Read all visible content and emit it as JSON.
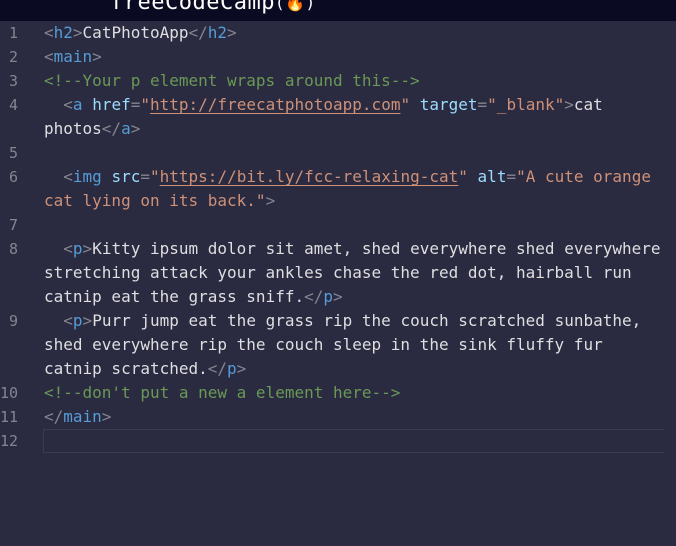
{
  "brand": {
    "name": "freeCodeCamp",
    "flame_icon": "flame-icon"
  },
  "colors": {
    "background": "#2a2a40",
    "topbar": "#0a0a23",
    "tag_name": "#569cd6",
    "attribute": "#9cdcfe",
    "string": "#ce9178",
    "comment": "#6a9955",
    "text": "#dfdfe2",
    "line_number": "#858591"
  },
  "editor": {
    "lines": [
      {
        "number": "1",
        "tokens": [
          {
            "t": "punct",
            "v": "<"
          },
          {
            "t": "tname",
            "v": "h2"
          },
          {
            "t": "punct",
            "v": ">"
          },
          {
            "t": "text",
            "v": "CatPhotoApp"
          },
          {
            "t": "punct",
            "v": "</"
          },
          {
            "t": "tname",
            "v": "h2"
          },
          {
            "t": "punct",
            "v": ">"
          }
        ]
      },
      {
        "number": "2",
        "tokens": [
          {
            "t": "punct",
            "v": "<"
          },
          {
            "t": "tname",
            "v": "main"
          },
          {
            "t": "punct",
            "v": ">"
          }
        ]
      },
      {
        "number": "3",
        "tokens": [
          {
            "t": "comment",
            "v": "<!--Your p element wraps around this-->"
          }
        ]
      },
      {
        "number": "4",
        "tokens": [
          {
            "t": "text",
            "v": "  "
          },
          {
            "t": "punct",
            "v": "<"
          },
          {
            "t": "tname",
            "v": "a"
          },
          {
            "t": "text",
            "v": " "
          },
          {
            "t": "attr",
            "v": "href"
          },
          {
            "t": "punct",
            "v": "="
          },
          {
            "t": "str",
            "v": "\""
          },
          {
            "t": "link",
            "v": "http://freecatphotoapp.com"
          },
          {
            "t": "str",
            "v": "\""
          },
          {
            "t": "text",
            "v": " "
          },
          {
            "t": "attr",
            "v": "target"
          },
          {
            "t": "punct",
            "v": "="
          },
          {
            "t": "str",
            "v": "\"_blank\""
          },
          {
            "t": "punct",
            "v": ">"
          },
          {
            "t": "text",
            "v": "cat photos"
          },
          {
            "t": "punct",
            "v": "</"
          },
          {
            "t": "tname",
            "v": "a"
          },
          {
            "t": "punct",
            "v": ">"
          }
        ]
      },
      {
        "number": "5",
        "tokens": []
      },
      {
        "number": "6",
        "tokens": [
          {
            "t": "text",
            "v": "  "
          },
          {
            "t": "punct",
            "v": "<"
          },
          {
            "t": "tname",
            "v": "img"
          },
          {
            "t": "text",
            "v": " "
          },
          {
            "t": "attr",
            "v": "src"
          },
          {
            "t": "punct",
            "v": "="
          },
          {
            "t": "str",
            "v": "\""
          },
          {
            "t": "link",
            "v": "https://bit.ly/fcc-relaxing-cat"
          },
          {
            "t": "str",
            "v": "\""
          },
          {
            "t": "text",
            "v": " "
          },
          {
            "t": "attr",
            "v": "alt"
          },
          {
            "t": "punct",
            "v": "="
          },
          {
            "t": "str",
            "v": "\"A cute orange cat lying on its back.\""
          },
          {
            "t": "punct",
            "v": ">"
          }
        ]
      },
      {
        "number": "7",
        "tokens": []
      },
      {
        "number": "8",
        "tokens": [
          {
            "t": "text",
            "v": "  "
          },
          {
            "t": "punct",
            "v": "<"
          },
          {
            "t": "tname",
            "v": "p"
          },
          {
            "t": "punct",
            "v": ">"
          },
          {
            "t": "text",
            "v": "Kitty ipsum dolor sit amet, shed everywhere shed everywhere stretching attack your ankles chase the red dot, hairball run catnip eat the grass sniff."
          },
          {
            "t": "punct",
            "v": "</"
          },
          {
            "t": "tname",
            "v": "p"
          },
          {
            "t": "punct",
            "v": ">"
          }
        ]
      },
      {
        "number": "9",
        "tokens": [
          {
            "t": "text",
            "v": "  "
          },
          {
            "t": "punct",
            "v": "<"
          },
          {
            "t": "tname",
            "v": "p"
          },
          {
            "t": "punct",
            "v": ">"
          },
          {
            "t": "text",
            "v": "Purr jump eat the grass rip the couch scratched sunbathe, shed everywhere rip the couch sleep in the sink fluffy fur catnip scratched."
          },
          {
            "t": "punct",
            "v": "</"
          },
          {
            "t": "tname",
            "v": "p"
          },
          {
            "t": "punct",
            "v": ">"
          }
        ]
      },
      {
        "number": "10",
        "tokens": [
          {
            "t": "comment",
            "v": "<!--don't put a new a element here-->"
          }
        ]
      },
      {
        "number": "11",
        "tokens": [
          {
            "t": "punct",
            "v": "</"
          },
          {
            "t": "tname",
            "v": "main"
          },
          {
            "t": "punct",
            "v": ">"
          }
        ]
      },
      {
        "number": "12",
        "tokens": [],
        "current": true
      }
    ]
  }
}
